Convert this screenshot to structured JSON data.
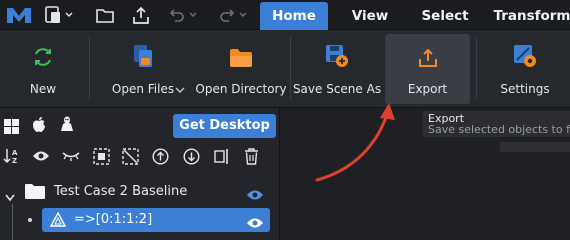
{
  "app": {
    "logo_icon": "app-logo-m-icon"
  },
  "topbar": {
    "quick_icons": [
      "new-file-icon",
      "chevron-down-icon",
      "open-folder-icon",
      "share-upload-icon",
      "undo-icon",
      "chevron-down-icon",
      "redo-icon",
      "chevron-down-icon"
    ],
    "tabs": [
      {
        "label": "Home",
        "active": true
      },
      {
        "label": "View",
        "active": false
      },
      {
        "label": "Select",
        "active": false
      },
      {
        "label": "Transform",
        "active": false
      }
    ]
  },
  "ribbon": {
    "buttons": [
      {
        "label": "New",
        "icon": "refresh-new-icon",
        "color": "#3fbf5a"
      },
      {
        "label": "Open Files",
        "icon": "open-files-icon",
        "color": "#3b7fd6",
        "has_dropdown": true
      },
      {
        "label": "Open Directory",
        "icon": "folder-icon",
        "color": "#f08a24"
      },
      {
        "label": "Save Scene As",
        "icon": "save-scene-icon",
        "color": "#3b7fd6"
      },
      {
        "label": "Export",
        "icon": "export-icon",
        "color": "#f08a24",
        "hovered": true
      },
      {
        "label": "Settings",
        "icon": "settings-icon",
        "color": "#3b7fd6"
      }
    ]
  },
  "tooltip": {
    "title": "Export",
    "description": "Save selected objects to file"
  },
  "panel": {
    "os_icons": [
      "windows-icon",
      "apple-icon",
      "linux-icon"
    ],
    "get_desktop_label": "Get Desktop",
    "toolbar_icons": [
      "sort-az-icon",
      "eye-icon",
      "eye-closed-icon",
      "select-box-icon",
      "deselect-box-icon",
      "move-up-icon",
      "move-down-icon",
      "split-icon",
      "trash-icon"
    ],
    "tree": [
      {
        "label": "Test Case 2 Baseline",
        "icon": "folder-icon",
        "expanded": true,
        "visible": true
      },
      {
        "label": "=>[0:1:1:2]",
        "icon": "mesh-triangle-icon",
        "selected": true,
        "visible": true
      }
    ]
  },
  "colors": {
    "accent": "#3b7fd6",
    "arrow": "#e0412f"
  }
}
